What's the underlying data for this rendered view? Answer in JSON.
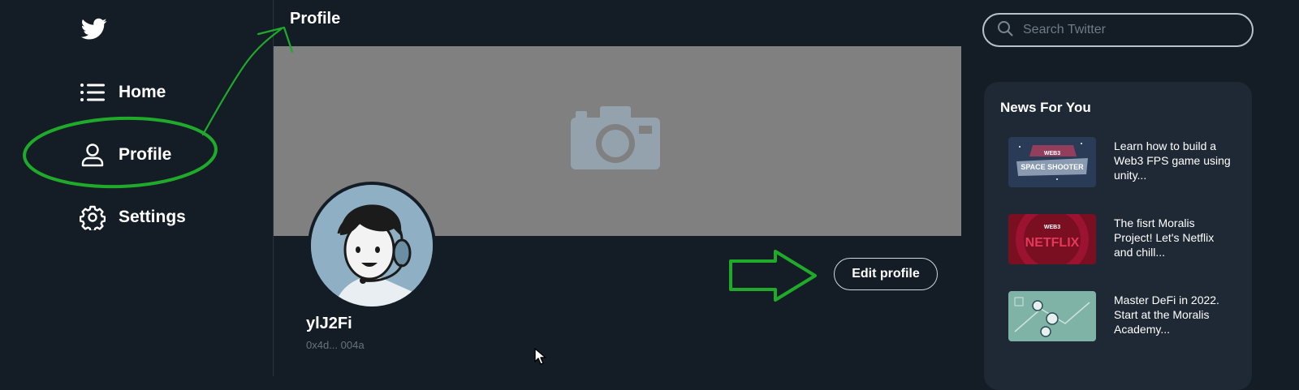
{
  "sidebar": {
    "logo_icon": "twitter-bird-icon",
    "items": [
      {
        "label": "Home",
        "icon": "list-icon"
      },
      {
        "label": "Profile",
        "icon": "user-icon"
      },
      {
        "label": "Settings",
        "icon": "gear-icon"
      }
    ]
  },
  "main": {
    "title": "Profile",
    "banner_icon": "camera-icon",
    "profile": {
      "username": "ylJ2Fi",
      "address": "0x4d... 004a",
      "edit_label": "Edit profile"
    }
  },
  "search": {
    "placeholder": "Search Twitter"
  },
  "news": {
    "title": "News For You",
    "items": [
      {
        "text": "Learn how to build a Web3 FPS game using unity...",
        "thumb_text": "WEB3 SPACE SHOOTER"
      },
      {
        "text": "The fisrt Moralis Project! Let's Netflix and chill...",
        "thumb_text": "WEB3 NETFLIX"
      },
      {
        "text": "Master DeFi in 2022. Start at the Moralis Academy...",
        "thumb_text": ""
      }
    ]
  },
  "colors": {
    "background": "#141d26",
    "panel": "#1f2935",
    "banner": "#808080",
    "annotation": "#1faa2a",
    "muted_text": "#67737e"
  }
}
